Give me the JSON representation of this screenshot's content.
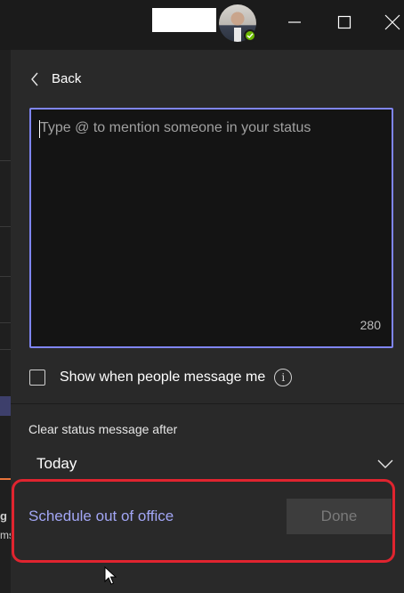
{
  "titlebar": {
    "icons": [
      "minimize-icon",
      "maximize-icon",
      "close-icon"
    ],
    "presence_color": "#6bb700"
  },
  "background_app": {
    "partial_texts": [
      "g",
      "ms"
    ]
  },
  "panel": {
    "back_label": "Back",
    "status_input": {
      "placeholder": "Type @ to mention someone in your status",
      "value": "",
      "char_remaining": "280",
      "border_color": "#7f85f5"
    },
    "show_when_message": {
      "label": "Show when people message me",
      "checked": false
    },
    "clear_after": {
      "label": "Clear status message after",
      "selected": "Today"
    },
    "schedule_link": "Schedule out of office",
    "done_button": "Done",
    "highlight_color": "#e0242f"
  }
}
